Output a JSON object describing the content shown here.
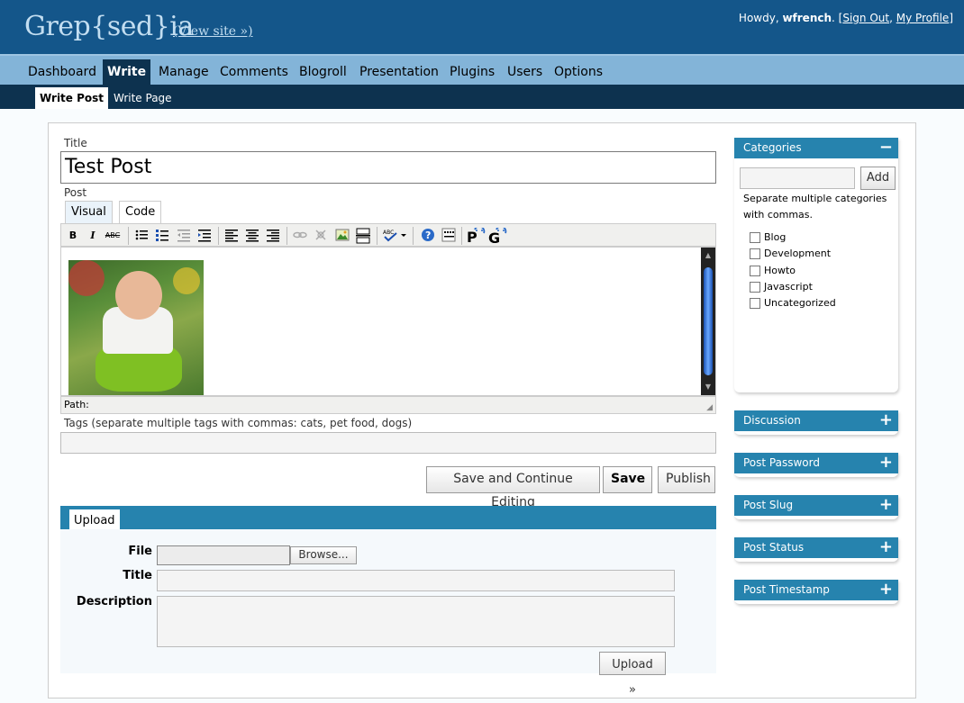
{
  "header": {
    "logo": "Grep{sed}ia",
    "view_site": "(View site »)",
    "greeting": "Howdy, ",
    "username": "wfrench",
    "sign_out": "Sign Out",
    "my_profile": "My Profile"
  },
  "nav": {
    "items": [
      "Dashboard",
      "Write",
      "Manage",
      "Comments",
      "Blogroll",
      "Presentation",
      "Plugins",
      "Users",
      "Options"
    ]
  },
  "subnav": {
    "items": [
      "Write Post",
      "Write Page"
    ]
  },
  "post": {
    "title_label": "Title",
    "title_value": "Test Post",
    "post_label": "Post",
    "tab_visual": "Visual",
    "tab_code": "Code",
    "path_label": "Path:",
    "tags_label": "Tags (separate multiple tags with commas: cats, pet food, dogs)",
    "tags_value": ""
  },
  "toolbar": {
    "bold": "B",
    "italic": "I",
    "strike": "ABC",
    "icons": [
      "bold-icon",
      "italic-icon",
      "strikethrough-icon",
      "bullet-list-icon",
      "numbered-list-icon",
      "outdent-icon",
      "indent-icon",
      "align-left-icon",
      "align-center-icon",
      "align-right-icon",
      "link-icon",
      "unlink-icon",
      "image-icon",
      "more-icon",
      "spellcheck-icon",
      "help-icon",
      "toggle-toolbar-icon"
    ]
  },
  "actions": {
    "save_continue": "Save and Continue Editing",
    "save": "Save",
    "publish": "Publish"
  },
  "upload": {
    "tab": "Upload",
    "file_label": "File",
    "browse": "Browse...",
    "title_label": "Title",
    "description_label": "Description",
    "upload_button": "Upload »"
  },
  "categories": {
    "header": "Categories",
    "toggle": "−",
    "add_button": "Add",
    "hint": "Separate multiple categories with commas.",
    "items": [
      "Blog",
      "Development",
      "Howto",
      "Javascript",
      "Uncategorized"
    ]
  },
  "sidebar": {
    "boxes": [
      "Discussion",
      "Post Password",
      "Post Slug",
      "Post Status",
      "Post Timestamp"
    ],
    "toggle": "+"
  },
  "colors": {
    "header_bg": "#14568a",
    "nav_bg": "#83b4d8",
    "subnav_bg": "#0d324f",
    "box_header": "#2683ae"
  }
}
